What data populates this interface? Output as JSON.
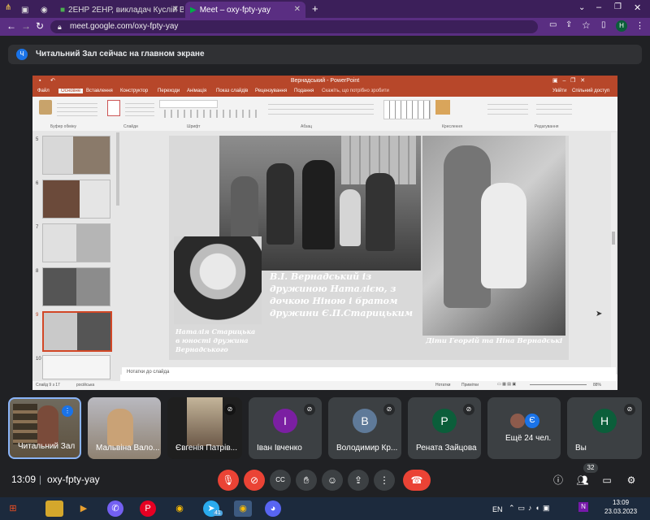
{
  "tabs": [
    {
      "label": "2ЕНР 2ЕНР, викладач Куслій В.М"
    },
    {
      "label": "Meet – oxy-fpty-yay"
    }
  ],
  "address": {
    "url": "meet.google.com/oxy-fpty-yay"
  },
  "presenting": {
    "avatar_letter": "Ч",
    "text": "Читальний Зал сейчас на главном экране"
  },
  "ppt": {
    "window_title": "Вернадський - PowerPoint",
    "menu": [
      "Файл",
      "Основне",
      "Вставлення",
      "Конструктор",
      "Переходи",
      "Анімація",
      "Показ слайдів",
      "Рецензування",
      "Подання",
      "Скажіть, що потрібно зробити"
    ],
    "account": "Увійти",
    "share": "Спільний доступ",
    "groups": [
      "Буфер обміну",
      "Слайди",
      "Шрифт",
      "Абзац",
      "Креслення",
      "Редагування"
    ],
    "thumb_numbers": [
      "5",
      "6",
      "7",
      "8",
      "9",
      "10"
    ],
    "notes_placeholder": "Нотатки до слайда",
    "status_left": "Слайд 9 з 17",
    "status_lang": "російська",
    "status_notes": "Нотатки",
    "status_comments": "Примітки",
    "zoom": "88%"
  },
  "slide": {
    "main_caption": "В.І. Вернадський із дружиною Наталією, з дочкою Ніною і братом дружини Є.П.Старицьким",
    "portrait_caption": "Наталія Старицька в юності дружина Вернадського",
    "children_caption": "Діти Георгій та Ніна Вернадські"
  },
  "participants": [
    {
      "name": "Читальний Зал",
      "type": "video"
    },
    {
      "name": "Мальвіна Вало...",
      "type": "video"
    },
    {
      "name": "Євгенія Патрів...",
      "type": "video"
    },
    {
      "name": "Іван Івченко",
      "letter": "І",
      "color": "#7b1fa2"
    },
    {
      "name": "Володимир Кр...",
      "letter": "В",
      "color": "#5f7a99"
    },
    {
      "name": "Рената Зайцова",
      "letter": "Р",
      "color": "#0b5e3a"
    },
    {
      "name": "Ещё 24 чел.",
      "letter": "Є",
      "color": "#1a73e8"
    },
    {
      "name": "Вы",
      "letter": "Н",
      "color": "#0b5e3a"
    }
  ],
  "controls": {
    "time": "13:09",
    "meeting_code": "oxy-fpty-yay",
    "people_count": "32"
  },
  "taskbar": {
    "lang": "EN",
    "clock_time": "13:09",
    "clock_date": "23.03.2023",
    "badge": "41"
  }
}
